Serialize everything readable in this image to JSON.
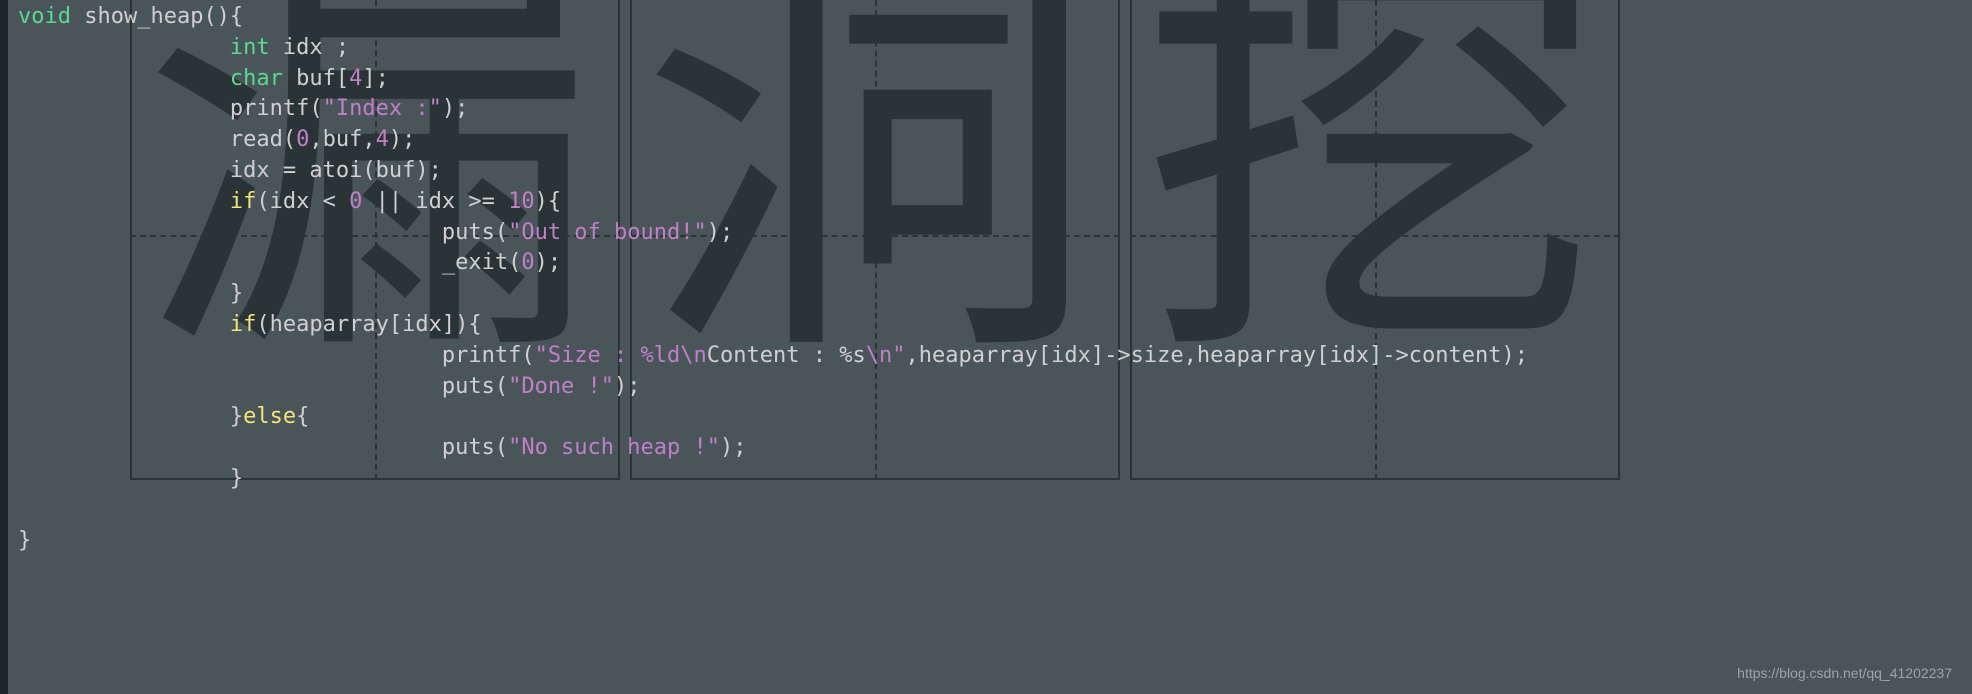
{
  "code": {
    "lines": [
      {
        "indent": 0,
        "tokens": [
          {
            "t": "kw-type",
            "v": "void"
          },
          {
            "t": "ident",
            "v": " show_heap"
          },
          {
            "t": "punct",
            "v": "(){"
          }
        ]
      },
      {
        "indent": 2,
        "tokens": [
          {
            "t": "kw-type",
            "v": "int"
          },
          {
            "t": "ident",
            "v": " idx "
          },
          {
            "t": "punct",
            "v": ";"
          }
        ]
      },
      {
        "indent": 2,
        "tokens": [
          {
            "t": "kw-type",
            "v": "char"
          },
          {
            "t": "ident",
            "v": " buf"
          },
          {
            "t": "punct",
            "v": "["
          },
          {
            "t": "num",
            "v": "4"
          },
          {
            "t": "punct",
            "v": "];"
          }
        ]
      },
      {
        "indent": 2,
        "tokens": [
          {
            "t": "func",
            "v": "printf"
          },
          {
            "t": "punct",
            "v": "("
          },
          {
            "t": "str",
            "v": "\"Index :\""
          },
          {
            "t": "punct",
            "v": ");"
          }
        ]
      },
      {
        "indent": 2,
        "tokens": [
          {
            "t": "func",
            "v": "read"
          },
          {
            "t": "punct",
            "v": "("
          },
          {
            "t": "num",
            "v": "0"
          },
          {
            "t": "punct",
            "v": ",buf,"
          },
          {
            "t": "num",
            "v": "4"
          },
          {
            "t": "punct",
            "v": ");"
          }
        ]
      },
      {
        "indent": 2,
        "tokens": [
          {
            "t": "ident",
            "v": "idx "
          },
          {
            "t": "punct",
            "v": "= "
          },
          {
            "t": "func",
            "v": "atoi"
          },
          {
            "t": "punct",
            "v": "(buf);"
          }
        ]
      },
      {
        "indent": 2,
        "tokens": [
          {
            "t": "kw-ctrl",
            "v": "if"
          },
          {
            "t": "punct",
            "v": "(idx < "
          },
          {
            "t": "num",
            "v": "0"
          },
          {
            "t": "punct",
            "v": " || idx >= "
          },
          {
            "t": "num",
            "v": "10"
          },
          {
            "t": "punct",
            "v": "){"
          }
        ]
      },
      {
        "indent": 4,
        "tokens": [
          {
            "t": "func",
            "v": "puts"
          },
          {
            "t": "punct",
            "v": "("
          },
          {
            "t": "str",
            "v": "\"Out of bound!\""
          },
          {
            "t": "punct",
            "v": ");"
          }
        ]
      },
      {
        "indent": 4,
        "tokens": [
          {
            "t": "func",
            "v": "_exit"
          },
          {
            "t": "punct",
            "v": "("
          },
          {
            "t": "num",
            "v": "0"
          },
          {
            "t": "punct",
            "v": ");"
          }
        ]
      },
      {
        "indent": 2,
        "tokens": [
          {
            "t": "punct",
            "v": "}"
          }
        ]
      },
      {
        "indent": 2,
        "tokens": [
          {
            "t": "kw-ctrl",
            "v": "if"
          },
          {
            "t": "punct",
            "v": "(heaparray[idx]){"
          }
        ]
      },
      {
        "indent": 4,
        "tokens": [
          {
            "t": "func",
            "v": "printf"
          },
          {
            "t": "punct",
            "v": "("
          },
          {
            "t": "str",
            "v": "\"Size : %ld\\n"
          },
          {
            "t": "ident",
            "v": "Content : %s"
          },
          {
            "t": "str",
            "v": "\\n\""
          },
          {
            "t": "punct",
            "v": ",heaparray[idx]->size,heaparray[idx]->content);"
          }
        ]
      },
      {
        "indent": 4,
        "tokens": [
          {
            "t": "func",
            "v": "puts"
          },
          {
            "t": "punct",
            "v": "("
          },
          {
            "t": "str",
            "v": "\"Done !\""
          },
          {
            "t": "punct",
            "v": ");"
          }
        ]
      },
      {
        "indent": 2,
        "tokens": [
          {
            "t": "punct",
            "v": "}"
          },
          {
            "t": "kw-ctrl",
            "v": "else"
          },
          {
            "t": "punct",
            "v": "{"
          }
        ]
      },
      {
        "indent": 4,
        "tokens": [
          {
            "t": "func",
            "v": "puts"
          },
          {
            "t": "punct",
            "v": "("
          },
          {
            "t": "str",
            "v": "\"No such heap !\""
          },
          {
            "t": "punct",
            "v": ");"
          }
        ]
      },
      {
        "indent": 2,
        "tokens": [
          {
            "t": "punct",
            "v": "}"
          }
        ]
      },
      {
        "indent": 0,
        "tokens": []
      },
      {
        "indent": 0,
        "tokens": [
          {
            "t": "punct",
            "v": "}"
          }
        ]
      }
    ]
  },
  "watermark": "https://blog.csdn.net/qq_41202237",
  "bg_chars": [
    "漏",
    "洞",
    "挖"
  ]
}
